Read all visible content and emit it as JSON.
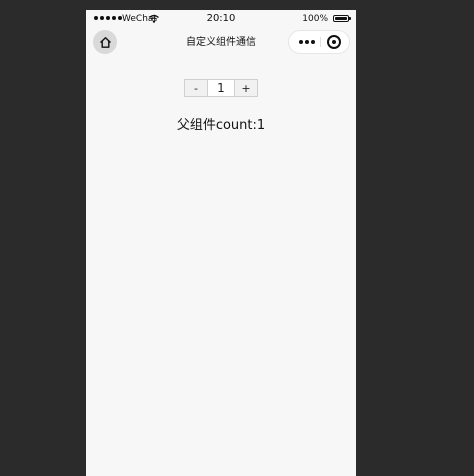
{
  "status_bar": {
    "carrier": "WeChat",
    "time": "20:10",
    "battery": "100%",
    "battery_level": 1.0
  },
  "nav": {
    "title": "自定义组件通信"
  },
  "counter": {
    "minus_label": "-",
    "value": "1",
    "plus_label": "+"
  },
  "parent": {
    "label": "父组件count:",
    "count": "1"
  },
  "icons": {
    "home": "home-icon",
    "more": "more-icon",
    "close": "close-icon"
  }
}
